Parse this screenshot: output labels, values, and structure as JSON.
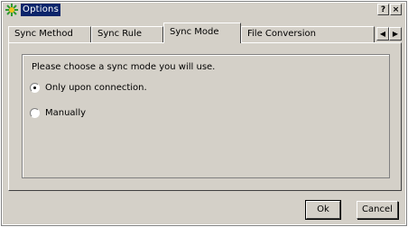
{
  "window": {
    "title": "Options",
    "help_label": "?",
    "close_label": "×"
  },
  "tabs": [
    {
      "label": "Sync Method",
      "active": false
    },
    {
      "label": "Sync Rule",
      "active": false
    },
    {
      "label": "Sync Mode",
      "active": true
    },
    {
      "label": "File Conversion",
      "active": false
    }
  ],
  "tab_scroll": {
    "left_icon": "left-arrow-icon",
    "right_icon": "right-arrow-icon"
  },
  "panel": {
    "prompt": "Please choose a sync mode you will use.",
    "options": [
      {
        "label": "Only upon connection.",
        "selected": true
      },
      {
        "label": "Manually",
        "selected": false
      }
    ]
  },
  "buttons": {
    "ok_label": "Ok",
    "cancel_label": "Cancel"
  },
  "colors": {
    "face": "#d4d0c8",
    "title_highlight": "#0a246a"
  }
}
